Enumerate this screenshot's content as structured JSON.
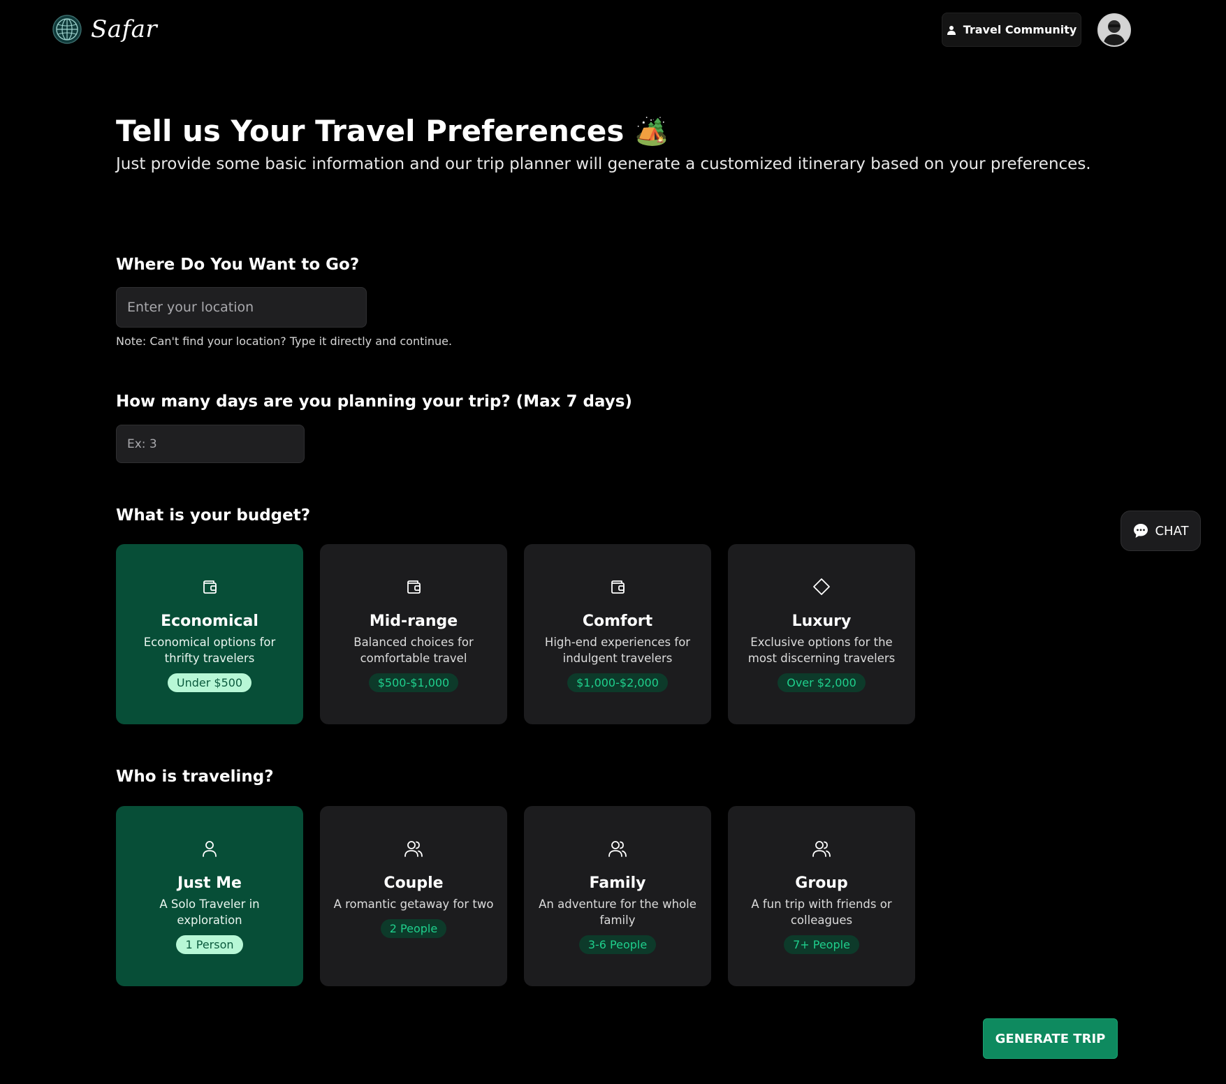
{
  "app": {
    "name": "Safar"
  },
  "header": {
    "community_label": "Travel Community"
  },
  "hero": {
    "title": "Tell us Your Travel Preferences",
    "title_emoji": "🏕️",
    "subtitle": "Just provide some basic information and our trip planner will generate a customized itinerary based on your preferences."
  },
  "destination": {
    "label": "Where Do You Want to Go?",
    "placeholder": "Enter your location",
    "value": "",
    "note": "Note: Can't find your location? Type it directly and continue."
  },
  "days": {
    "label": "How many days are you planning your trip? (Max 7 days)",
    "placeholder": "Ex: 3",
    "value": ""
  },
  "budget": {
    "label": "What is your budget?",
    "options": [
      {
        "title": "Economical",
        "desc": "Economical options for thrifty travelers",
        "badge": "Under $500",
        "icon": "wallet-icon",
        "selected": true
      },
      {
        "title": "Mid-range",
        "desc": "Balanced choices for comfortable travel",
        "badge": "$500-$1,000",
        "icon": "wallet-icon",
        "selected": false
      },
      {
        "title": "Comfort",
        "desc": "High-end experiences for indulgent travelers",
        "badge": "$1,000-$2,000",
        "icon": "wallet-icon",
        "selected": false
      },
      {
        "title": "Luxury",
        "desc": "Exclusive options for the most discerning travelers",
        "badge": "Over $2,000",
        "icon": "diamond-icon",
        "selected": false
      }
    ]
  },
  "travelers": {
    "label": "Who is traveling?",
    "options": [
      {
        "title": "Just Me",
        "desc": "A Solo Traveler in exploration",
        "badge": "1 Person",
        "icon": "user-icon",
        "selected": true
      },
      {
        "title": "Couple",
        "desc": "A romantic getaway for two",
        "badge": "2 People",
        "icon": "users-icon",
        "selected": false
      },
      {
        "title": "Family",
        "desc": "An adventure for the whole family",
        "badge": "3-6 People",
        "icon": "users-icon",
        "selected": false
      },
      {
        "title": "Group",
        "desc": "A fun trip with friends or colleagues",
        "badge": "7+ People",
        "icon": "users-icon",
        "selected": false
      }
    ]
  },
  "chat": {
    "label": "CHAT"
  },
  "actions": {
    "generate_label": "GENERATE TRIP"
  },
  "colors": {
    "background": "#000000",
    "card": "#1c1c1e",
    "card_selected": "#074e37",
    "accent": "#0e8a5f",
    "badge_text": "#1fcf8c"
  }
}
